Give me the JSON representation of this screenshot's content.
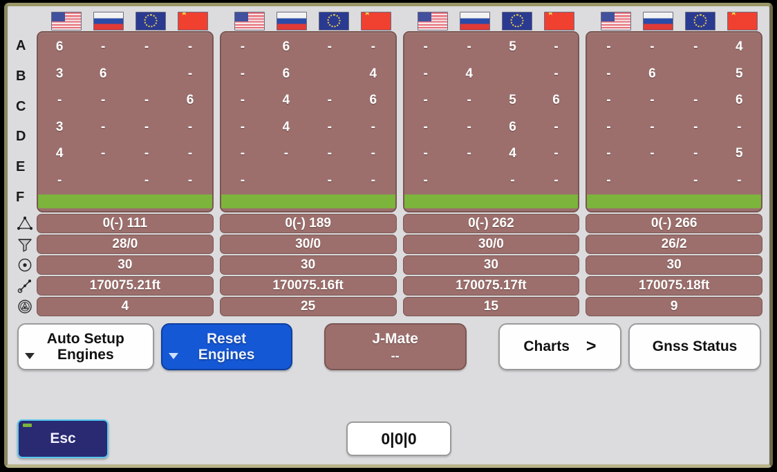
{
  "constellations": [
    {
      "name": "gps-flag",
      "label": "USA",
      "class": "flag-us"
    },
    {
      "name": "glonass-flag",
      "label": "Russia",
      "class": "flag-ru"
    },
    {
      "name": "galileo-flag",
      "label": "European Union",
      "class": "flag-eu"
    },
    {
      "name": "beidou-flag",
      "label": "China",
      "class": "flag-cn"
    }
  ],
  "row_labels": [
    "A",
    "B",
    "C",
    "D",
    "E",
    "F"
  ],
  "panels": [
    {
      "id": "engine-1",
      "rows": [
        [
          "6",
          "-",
          "-",
          "-"
        ],
        [
          "3",
          "6",
          "",
          "-"
        ],
        [
          "-",
          "-",
          "-",
          "6"
        ],
        [
          "3",
          "-",
          "-",
          "-"
        ],
        [
          "4",
          "-",
          "-",
          "-"
        ],
        [
          "-",
          "",
          "-",
          "-"
        ]
      ],
      "stats": {
        "solution": "0(-) 111",
        "satellites": "28/0",
        "tracked": "30",
        "baseline": "170075.21ft",
        "age": "4"
      }
    },
    {
      "id": "engine-2",
      "rows": [
        [
          "-",
          "6",
          "-",
          "-"
        ],
        [
          "-",
          "6",
          "",
          "4"
        ],
        [
          "-",
          "4",
          "-",
          "6"
        ],
        [
          "-",
          "4",
          "-",
          "-"
        ],
        [
          "-",
          "-",
          "-",
          "-"
        ],
        [
          "-",
          "",
          "-",
          "-"
        ]
      ],
      "stats": {
        "solution": "0(-) 189",
        "satellites": "30/0",
        "tracked": "30",
        "baseline": "170075.16ft",
        "age": "25"
      }
    },
    {
      "id": "engine-3",
      "rows": [
        [
          "-",
          "-",
          "5",
          "-"
        ],
        [
          "-",
          "4",
          "",
          "-"
        ],
        [
          "-",
          "-",
          "5",
          "6"
        ],
        [
          "-",
          "-",
          "6",
          "-"
        ],
        [
          "-",
          "-",
          "4",
          "-"
        ],
        [
          "-",
          "",
          "-",
          "-"
        ]
      ],
      "stats": {
        "solution": "0(-) 262",
        "satellites": "30/0",
        "tracked": "30",
        "baseline": "170075.17ft",
        "age": "15"
      }
    },
    {
      "id": "engine-4",
      "rows": [
        [
          "-",
          "-",
          "-",
          "4"
        ],
        [
          "-",
          "6",
          "",
          "5"
        ],
        [
          "-",
          "-",
          "-",
          "6"
        ],
        [
          "-",
          "-",
          "-",
          "-"
        ],
        [
          "-",
          "-",
          "-",
          "5"
        ],
        [
          "-",
          "",
          "-",
          "-"
        ]
      ],
      "stats": {
        "solution": "0(-) 266",
        "satellites": "26/2",
        "tracked": "30",
        "baseline": "170075.18ft",
        "age": "9"
      }
    }
  ],
  "stat_rows": [
    {
      "key": "solution",
      "icon": "triangle-network-icon"
    },
    {
      "key": "satellites",
      "icon": "filter-funnel-icon"
    },
    {
      "key": "tracked",
      "icon": "target-circle-icon"
    },
    {
      "key": "baseline",
      "icon": "baseline-vector-icon"
    },
    {
      "key": "age",
      "icon": "antenna-circle-icon"
    }
  ],
  "buttons": {
    "auto_setup": {
      "line1": "Auto Setup",
      "line2": "Engines"
    },
    "reset": {
      "line1": "Reset",
      "line2": "Engines"
    },
    "jmate": {
      "line1": "J-Mate",
      "line2": "--"
    },
    "charts": {
      "label": "Charts",
      "chevron": ">"
    },
    "gnss_status": {
      "label": "Gnss Status"
    },
    "esc": {
      "label": "Esc"
    }
  },
  "counter": {
    "value": "0|0|0"
  },
  "colors": {
    "panel": "#9c6f6c",
    "health_bar": "#7cb43c",
    "accent_blue": "#1558d6",
    "esc_navy": "#2a2a72",
    "bezel": "#8d8a5e"
  }
}
